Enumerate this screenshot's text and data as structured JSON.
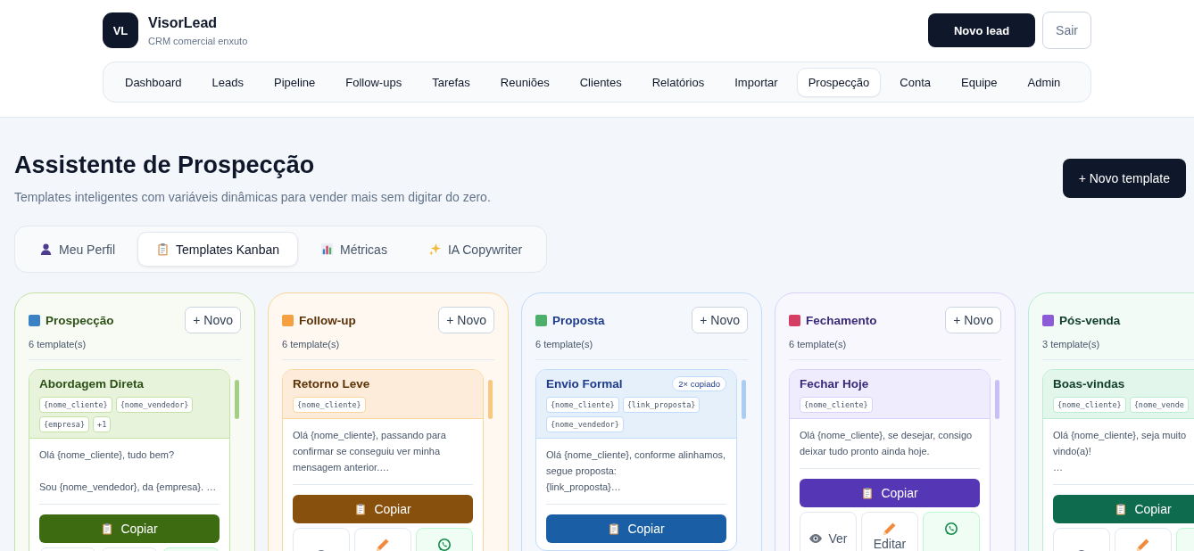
{
  "brand": {
    "logo": "VL",
    "name": "VisorLead",
    "tagline": "CRM comercial enxuto"
  },
  "header_buttons": {
    "primary": "Novo lead",
    "secondary": "Sair"
  },
  "nav": [
    {
      "label": "Dashboard",
      "selected": false
    },
    {
      "label": "Leads",
      "selected": false
    },
    {
      "label": "Pipeline",
      "selected": false
    },
    {
      "label": "Follow-ups",
      "selected": false
    },
    {
      "label": "Tarefas",
      "selected": false
    },
    {
      "label": "Reuniões",
      "selected": false
    },
    {
      "label": "Clientes",
      "selected": false
    },
    {
      "label": "Relatórios",
      "selected": false
    },
    {
      "label": "Importar",
      "selected": false
    },
    {
      "label": "Prospecção",
      "selected": true
    },
    {
      "label": "Conta",
      "selected": false
    },
    {
      "label": "Equipe",
      "selected": false
    },
    {
      "label": "Admin",
      "selected": false
    }
  ],
  "page": {
    "title": "Assistente de Prospecção",
    "subtitle": "Templates inteligentes com variáveis dinâmicas para vender mais sem digitar do zero.",
    "new_button": "+ Novo template"
  },
  "tabs": [
    {
      "kind": "profile",
      "label": "Meu Perfil",
      "selected": false
    },
    {
      "kind": "templates",
      "label": "Templates Kanban",
      "selected": true
    },
    {
      "kind": "metrics",
      "label": "Métricas",
      "selected": false
    },
    {
      "kind": "ai",
      "label": "IA Copywriter",
      "selected": false
    }
  ],
  "columns": [
    {
      "title": "Prospecção",
      "color": "#3b82c4",
      "count": "6 template(s)",
      "new_button": "+ Novo",
      "card": {
        "title": "Abordagem Direta",
        "tags": [
          "{nome_cliente}",
          "{nome_vendedor}",
          "{empresa}",
          "+1"
        ],
        "preview": "Olá {nome_cliente}, tudo bem?\n\nSou {nome_vendedor}, da {empresa}. …",
        "copy": "Copiar",
        "actions": [
          {
            "kind": "view"
          },
          {
            "kind": "edit"
          },
          {
            "kind": "whatsapp"
          }
        ]
      }
    },
    {
      "title": "Follow-up",
      "color": "#f5a142",
      "count": "6 template(s)",
      "new_button": "+ Novo",
      "card": {
        "title": "Retorno Leve",
        "tags": [
          "{nome_cliente}"
        ],
        "preview": "Olá {nome_cliente}, passando para confirmar se conseguiu ver minha mensagem anterior.…",
        "copy": "Copiar",
        "actions": [
          {
            "kind": "view"
          },
          {
            "kind": "edit"
          },
          {
            "kind": "whatsapp"
          }
        ]
      }
    },
    {
      "title": "Proposta",
      "color": "#4caf6a",
      "count": "6 template(s)",
      "new_button": "+ Novo",
      "card": {
        "title": "Envio Formal",
        "badge": "2× copiado",
        "tags": [
          "{nome_cliente}",
          "{link_proposta}",
          "{nome_vendedor}"
        ],
        "preview": "Olá {nome_cliente}, conforme alinhamos, segue proposta:\n{link_proposta}…",
        "copy": "Copiar"
      }
    },
    {
      "title": "Fechamento",
      "color": "#d63d63",
      "count": "6 template(s)",
      "new_button": "+ Novo",
      "card": {
        "title": "Fechar Hoje",
        "tags": [
          "{nome_cliente}"
        ],
        "preview": "Olá {nome_cliente}, se desejar, consigo deixar tudo pronto ainda hoje.",
        "copy": "Copiar",
        "actions": [
          {
            "kind": "view",
            "label": "Ver"
          },
          {
            "kind": "edit",
            "label": "Editar"
          },
          {
            "kind": "whatsapp"
          }
        ]
      }
    },
    {
      "title": "Pós-venda",
      "color": "#8b5cd6",
      "count": "3 template(s)",
      "card": {
        "title": "Boas-vindas",
        "tags": [
          "{nome_cliente}",
          "{nome_vende"
        ],
        "preview": "Olá {nome_cliente}, seja muito\nvindo(a)!\n…",
        "copy": "Copiar",
        "actions": [
          {
            "kind": "view"
          },
          {
            "kind": "edit"
          },
          {
            "kind": "whatsapp"
          }
        ]
      }
    }
  ]
}
